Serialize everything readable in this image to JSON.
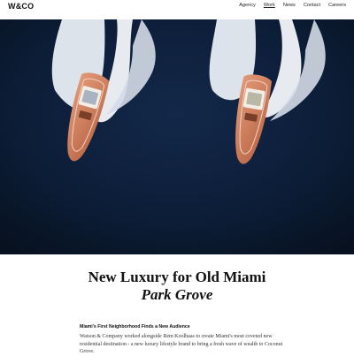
{
  "header": {
    "logo": "W&CO",
    "nav": [
      {
        "label": "Agency"
      },
      {
        "label": "Work",
        "active": true
      },
      {
        "label": "News"
      },
      {
        "label": "Contact"
      },
      {
        "label": "Careers"
      }
    ]
  },
  "hero": {
    "water_color": "#0b1b30",
    "boat_color": "#c8734f"
  },
  "project": {
    "title": "New Luxury for Old Miami",
    "subtitle": "Park Grove"
  },
  "section": {
    "heading": "Miami's First Neighborhood Finds a New Audience",
    "body": "Watson & Company worked alongside Rem Koolhaas to create Miami's most coveted new residential destination - a new luxury lifestyle brand to bring a fresh wave of wealth to Coconut Grove."
  }
}
